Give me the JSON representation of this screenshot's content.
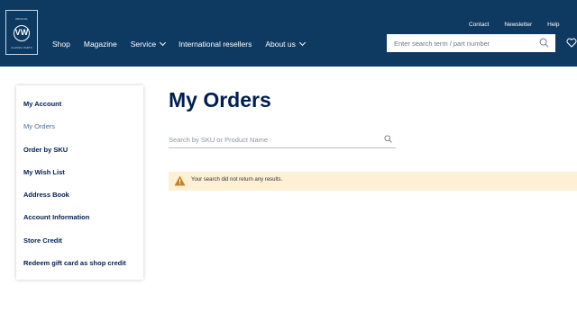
{
  "header": {
    "logo": {
      "top_text": "ORIGINAL",
      "mark": "VW",
      "bottom_text": "CLASSIC PARTS"
    },
    "nav": [
      {
        "label": "Shop",
        "has_dropdown": false
      },
      {
        "label": "Magazine",
        "has_dropdown": false
      },
      {
        "label": "Service",
        "has_dropdown": true
      },
      {
        "label": "International resellers",
        "has_dropdown": false
      },
      {
        "label": "About us",
        "has_dropdown": true
      }
    ],
    "top_links": {
      "contact": "Contact",
      "newsletter": "Newsletter",
      "help": "Help"
    },
    "search": {
      "placeholder": "Enter search term / part number",
      "icon": "search-icon"
    },
    "wishlist_icon": "heart-icon"
  },
  "sidebar": {
    "items": [
      {
        "label": "My Account",
        "active": false
      },
      {
        "label": "My Orders",
        "active": true
      },
      {
        "label": "Order by SKU",
        "active": false
      },
      {
        "label": "My Wish List",
        "active": false
      },
      {
        "label": "Address Book",
        "active": false
      },
      {
        "label": "Account Information",
        "active": false
      },
      {
        "label": "Store Credit",
        "active": false
      },
      {
        "label": "Redeem gift card as shop credit",
        "active": false
      }
    ]
  },
  "main": {
    "title": "My Orders",
    "search": {
      "placeholder": "Search by SKU or Product Name",
      "icon": "search-icon"
    },
    "notice": {
      "text": "Your search did not return any results.",
      "icon": "warning-icon"
    }
  },
  "colors": {
    "header_bg": "#0e3a62",
    "text": "#001e50",
    "active": "#4f6d8e",
    "notice_bg": "#fdf0d5",
    "warning": "#c8832a"
  }
}
